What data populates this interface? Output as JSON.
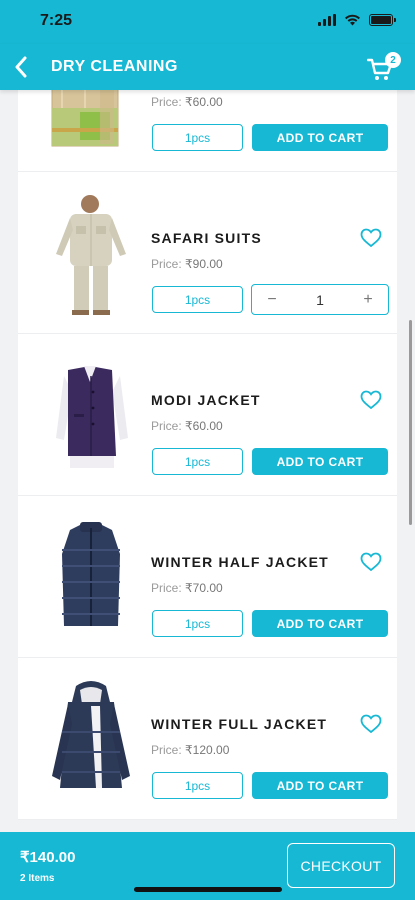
{
  "status_bar": {
    "time": "7:25"
  },
  "app_bar": {
    "title": "DRY CLEANING",
    "cart_count": "2"
  },
  "products": [
    {
      "name": "",
      "price_label": "Price:",
      "price": "₹60.00",
      "qty_label": "1pcs",
      "action": "ADD TO CART",
      "in_cart": false,
      "quantity": "",
      "image": "saree"
    },
    {
      "name": "SAFARI SUITS",
      "price_label": "Price:",
      "price": "₹90.00",
      "qty_label": "1pcs",
      "action": "",
      "in_cart": true,
      "quantity": "1",
      "image": "safari-suit"
    },
    {
      "name": "MODI JACKET",
      "price_label": "Price:",
      "price": "₹60.00",
      "qty_label": "1pcs",
      "action": "ADD TO CART",
      "in_cart": false,
      "quantity": "",
      "image": "modi-jacket"
    },
    {
      "name": "WINTER HALF JACKET",
      "price_label": "Price:",
      "price": "₹70.00",
      "qty_label": "1pcs",
      "action": "ADD TO CART",
      "in_cart": false,
      "quantity": "",
      "image": "half-jacket"
    },
    {
      "name": "WINTER FULL JACKET",
      "price_label": "Price:",
      "price": "₹120.00",
      "qty_label": "1pcs",
      "action": "ADD TO CART",
      "in_cart": false,
      "quantity": "",
      "image": "full-jacket"
    }
  ],
  "stepper": {
    "minus": "−",
    "plus": "+"
  },
  "footer": {
    "total": "₹140.00",
    "items": "2 Items",
    "checkout": "CHECKOUT"
  },
  "colors": {
    "accent": "#17b8d4",
    "background": "#f1f2f4"
  }
}
